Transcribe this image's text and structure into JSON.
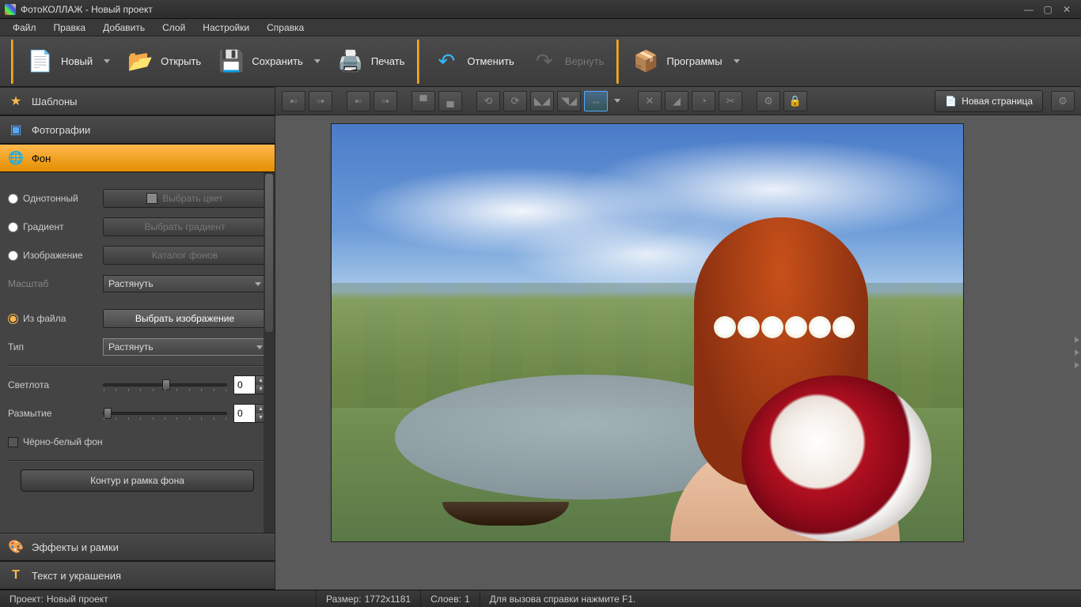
{
  "title": "ФотоКОЛЛАЖ - Новый проект",
  "menu": [
    "Файл",
    "Правка",
    "Добавить",
    "Слой",
    "Настройки",
    "Справка"
  ],
  "toolbar": {
    "new": "Новый",
    "open": "Открыть",
    "save": "Сохранить",
    "print": "Печать",
    "undo": "Отменить",
    "redo": "Вернуть",
    "programs": "Программы"
  },
  "accordion": {
    "templates": "Шаблоны",
    "photos": "Фотографии",
    "background": "Фон",
    "effects": "Эффекты и рамки",
    "text": "Текст и украшения"
  },
  "bg_panel": {
    "solid": "Однотонный",
    "pick_color": "Выбрать цвет",
    "gradient": "Градиент",
    "pick_gradient": "Выбрать градиент",
    "image": "Изображение",
    "catalog": "Каталог фонов",
    "scale": "Масштаб",
    "scale_value": "Растянуть",
    "from_file": "Из файла",
    "pick_image": "Выбрать изображение",
    "type": "Тип",
    "type_value": "Растянуть",
    "brightness": "Светлота",
    "brightness_value": "0",
    "blur": "Размытие",
    "blur_value": "0",
    "bw": "Чёрно-белый фон",
    "contour": "Контур и рамка фона"
  },
  "canvas_toolbar": {
    "new_page": "Новая страница"
  },
  "status": {
    "project_label": "Проект:",
    "project_value": "Новый проект",
    "size_label": "Размер:",
    "size_value": "1772x1181",
    "layers_label": "Слоев:",
    "layers_value": "1",
    "help": "Для вызова справки нажмите F1."
  }
}
